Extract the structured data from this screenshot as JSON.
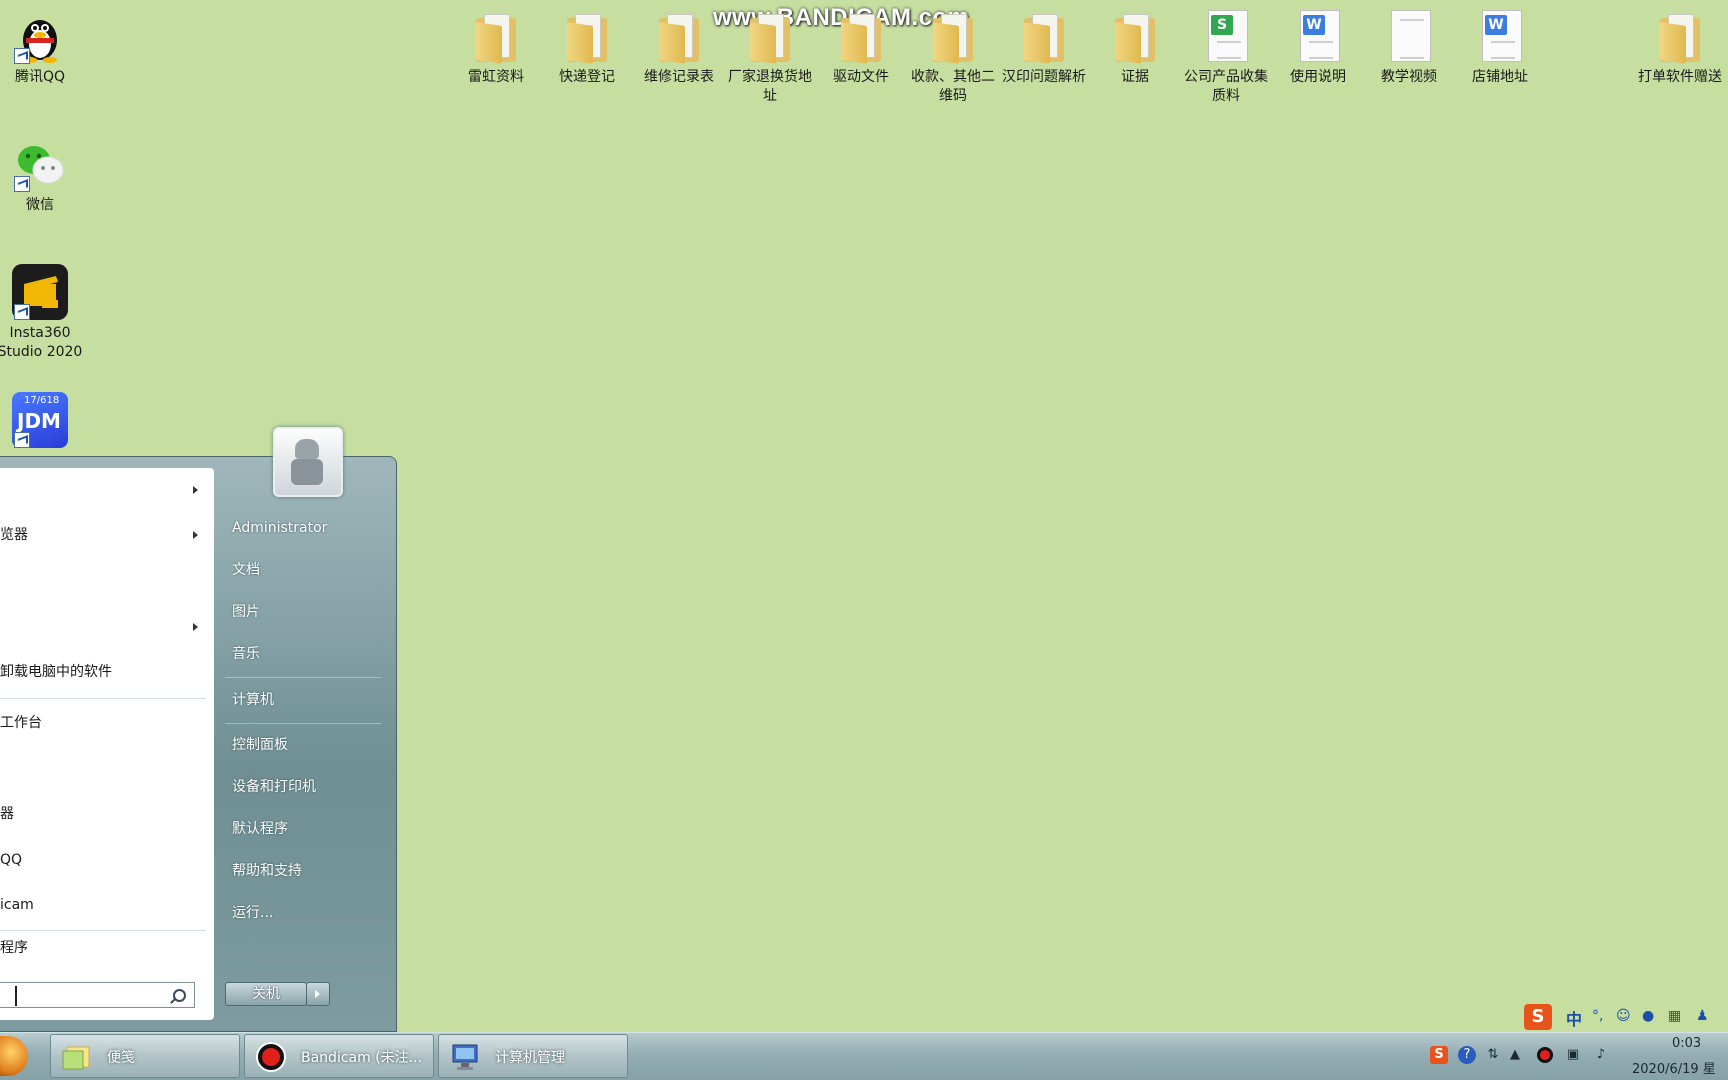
{
  "watermark": "www.BANDICAM.com",
  "desktop_left_icons": [
    {
      "label": "腾讯QQ",
      "icon": "qq-penguin-icon"
    },
    {
      "label": "微信",
      "icon": "wechat-icon"
    },
    {
      "label": "Insta360 Studio 2020",
      "icon": "insta360-icon"
    },
    {
      "label": "",
      "icon": "jdm-icon",
      "badge": "17/618",
      "text": "JDM"
    }
  ],
  "desktop_top_icons": [
    {
      "label": "雷虹资料",
      "type": "folder"
    },
    {
      "label": "快递登记",
      "type": "folder"
    },
    {
      "label": "维修记录表",
      "type": "folder"
    },
    {
      "label": "厂家退换货地址",
      "type": "folder"
    },
    {
      "label": "驱动文件",
      "type": "folder"
    },
    {
      "label": "收款、其他二维码",
      "type": "folder"
    },
    {
      "label": "汉印问题解析",
      "type": "folder"
    },
    {
      "label": "证据",
      "type": "folder"
    },
    {
      "label": "公司产品收集质料",
      "type": "sheet",
      "badge": "S"
    },
    {
      "label": "使用说明",
      "type": "word",
      "badge": "W"
    },
    {
      "label": "教学视频",
      "type": "text"
    },
    {
      "label": "店铺地址",
      "type": "word",
      "badge": "W"
    },
    {
      "label": "打单软件赠送",
      "type": "folder"
    }
  ],
  "start_menu": {
    "left_items": [
      {
        "label": "",
        "has_arrow": true
      },
      {
        "label": "览器",
        "has_arrow": true
      },
      {
        "label": "",
        "has_arrow": true
      },
      {
        "label": "卸载电脑中的软件",
        "has_arrow": false
      },
      {
        "label": "工作台",
        "has_arrow": false
      },
      {
        "label": "器",
        "has_arrow": false
      },
      {
        "label": "QQ",
        "has_arrow": false
      },
      {
        "label": "icam",
        "has_arrow": false
      },
      {
        "label": "程序",
        "has_arrow": false
      }
    ],
    "right_items": [
      "Administrator",
      "文档",
      "图片",
      "音乐",
      "计算机",
      "控制面板",
      "设备和打印机",
      "默认程序",
      "帮助和支持",
      "运行..."
    ],
    "shutdown_label": "关机",
    "search_placeholder": ""
  },
  "taskbar": {
    "buttons": [
      {
        "label": "便笺",
        "icon": "sticky-notes-icon"
      },
      {
        "label": "Bandicam (未注...",
        "icon": "bandicam-record-icon"
      },
      {
        "label": "计算机管理",
        "icon": "computer-management-icon"
      }
    ],
    "clock_time": "0:03",
    "clock_date": "2020/6/19 星"
  },
  "ime": {
    "logo": "S",
    "mode": "中",
    "punct": "°,"
  },
  "colors": {
    "desktop": "#c6dfa0",
    "accent": "#e8531c",
    "folder": "#e3c066"
  }
}
